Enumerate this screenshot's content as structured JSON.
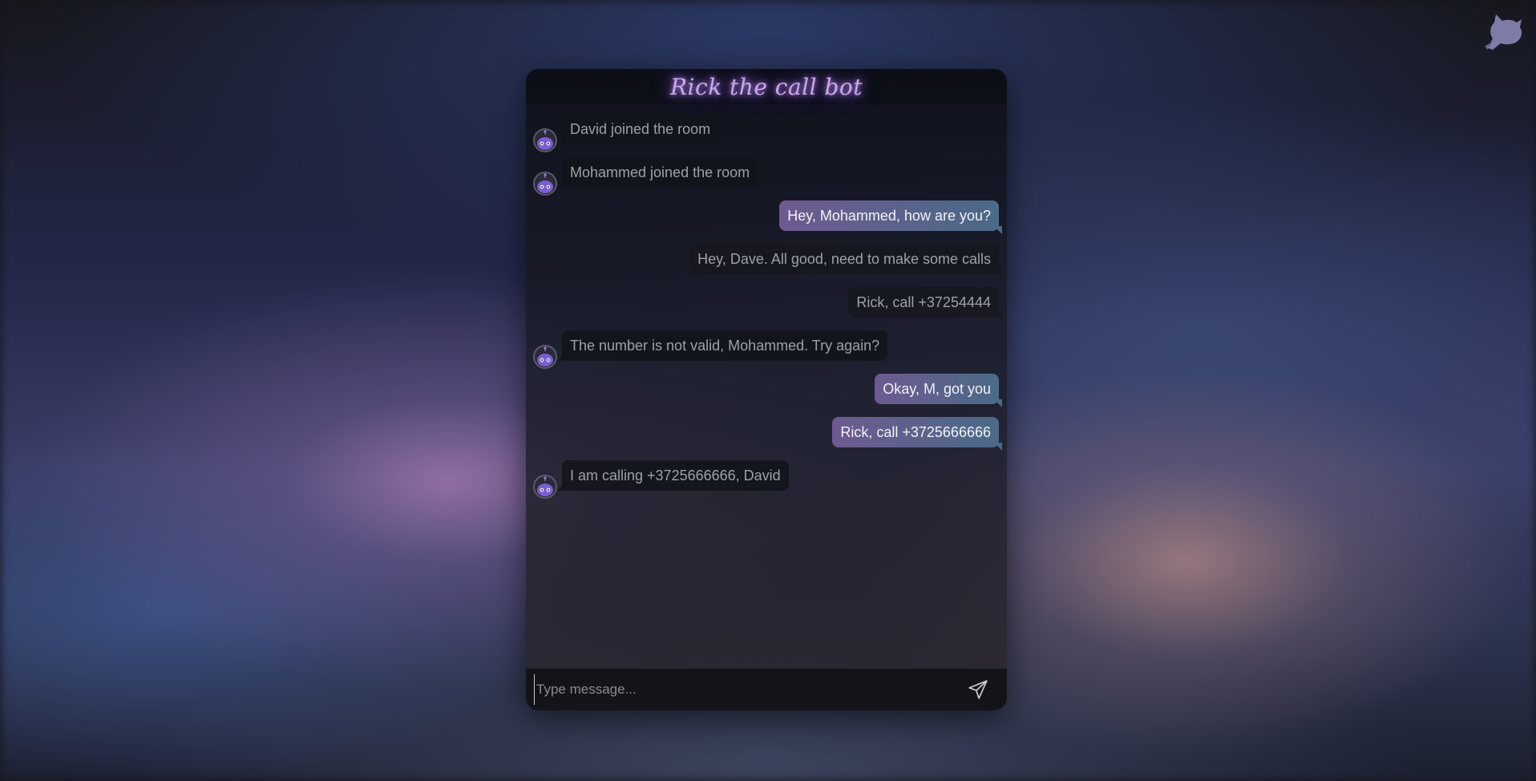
{
  "chat": {
    "title": "Rick the call bot",
    "input_placeholder": "Type message...",
    "messages": [
      {
        "type": "bot",
        "text": "David joined the room"
      },
      {
        "type": "bot",
        "text": "Mohammed joined the room"
      },
      {
        "type": "self",
        "text": "Hey, Mohammed, how are you?"
      },
      {
        "type": "other",
        "text": "Hey, Dave. All good, need to make some calls"
      },
      {
        "type": "other",
        "text": "Rick, call +37254444"
      },
      {
        "type": "bot",
        "text": "The number is not valid, Mohammed. Try again?"
      },
      {
        "type": "self",
        "text": "Okay, M, got you"
      },
      {
        "type": "self",
        "text": "Rick, call +3725666666"
      },
      {
        "type": "bot",
        "text": "I am calling +3725666666, David"
      }
    ]
  },
  "icons": {
    "corner": "cat-logo-icon",
    "avatar": "robot-icon",
    "send": "paper-plane-icon"
  },
  "colors": {
    "title_glow": "#c9a9e8",
    "self_bubble_start": "#6e5a90",
    "self_bubble_end": "#4a6a88"
  }
}
